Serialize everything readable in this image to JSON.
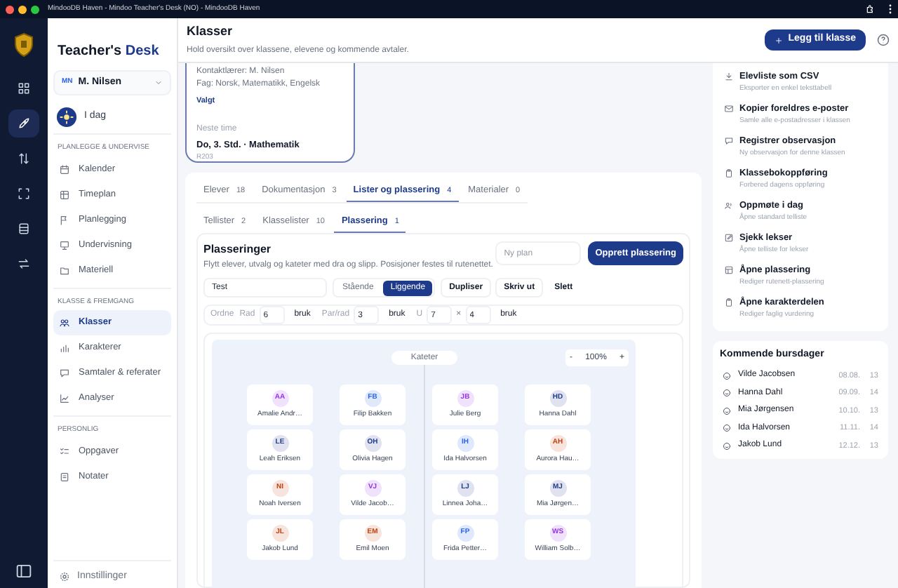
{
  "window": {
    "title": "MindooDB Haven - Mindoo Teacher's Desk (NO) - MindooDB Haven"
  },
  "rail": [
    {
      "selected": false
    },
    {
      "selected": true
    },
    {
      "selected": false
    },
    {
      "selected": false
    },
    {
      "selected": false
    },
    {
      "selected": false
    }
  ],
  "sidebar": {
    "brand_prefix": "Teacher's",
    "brand_accent": "Desk",
    "user": {
      "initials": "MN",
      "name": "M. Nilsen"
    },
    "today": "I dag",
    "sections": [
      {
        "title": "PLANLEGGE & UNDERVISE",
        "items": [
          {
            "label": "Kalender",
            "selected": false
          },
          {
            "label": "Timeplan",
            "selected": false
          },
          {
            "label": "Planlegging",
            "selected": false
          },
          {
            "label": "Undervisning",
            "selected": false
          },
          {
            "label": "Materiell",
            "selected": false
          }
        ]
      },
      {
        "title": "KLASSE & FREMGANG",
        "items": [
          {
            "label": "Klasser",
            "selected": true
          },
          {
            "label": "Karakterer",
            "selected": false
          },
          {
            "label": "Samtaler & referater",
            "selected": false
          },
          {
            "label": "Analyser",
            "selected": false
          }
        ]
      },
      {
        "title": "PERSONLIG",
        "items": [
          {
            "label": "Oppgaver",
            "selected": false
          },
          {
            "label": "Notater",
            "selected": false
          }
        ]
      }
    ],
    "settings": "Innstillinger"
  },
  "header": {
    "title": "Klasser",
    "subtitle": "Hold oversikt over klassene, elevene og kommende avtaler.",
    "add_button": "Legg til klasse"
  },
  "class_card": {
    "lines": [
      "Kontaktlærer: M. Nilsen",
      "Fag: Norsk, Matematikk, Engelsk"
    ],
    "status": "Valgt",
    "next_label": "Neste time",
    "next_lesson": "Do, 3. Std. · Mathematik",
    "room": "R203"
  },
  "tabs": [
    {
      "label": "Elever",
      "count": "18",
      "selected": false
    },
    {
      "label": "Dokumentasjon",
      "count": "3",
      "selected": false
    },
    {
      "label": "Lister og plassering",
      "count": "4",
      "selected": true
    },
    {
      "label": "Materialer",
      "count": "0",
      "selected": false
    }
  ],
  "subtabs": [
    {
      "label": "Tellister",
      "count": "2",
      "selected": false
    },
    {
      "label": "Klasselister",
      "count": "10",
      "selected": false
    },
    {
      "label": "Plassering",
      "count": "1",
      "selected": true
    }
  ],
  "seating": {
    "title": "Plasseringer",
    "description": "Flytt elever, utvalg og kateter med dra og slipp. Posisjoner festes til rutenettet.",
    "new_plan_placeholder": "Ny plan",
    "create_button": "Opprett plassering",
    "plan_name": "Test",
    "orientation": [
      {
        "label": "Stående",
        "selected": false
      },
      {
        "label": "Liggende",
        "selected": true
      }
    ],
    "actions": [
      "Dupliser",
      "Skriv ut",
      "Slett"
    ],
    "arrange": {
      "label": "Ordne",
      "groups": [
        {
          "label": "Rad",
          "values": [
            "6"
          ],
          "apply": "bruk"
        },
        {
          "label": "Par/rad",
          "values": [
            "3"
          ],
          "apply": "bruk"
        },
        {
          "label": "U",
          "values": [
            "7",
            "4"
          ],
          "separator": "×",
          "apply": "bruk"
        }
      ]
    }
  },
  "canvas": {
    "desk_label": "Kateter",
    "zoom_out": "-",
    "zoom": "100%",
    "zoom_in": "+",
    "students": [
      {
        "initials": "AA",
        "name": "Amalie Andr…",
        "color": "#9333ea"
      },
      {
        "initials": "FB",
        "name": "Filip Bakken",
        "color": "#2563eb"
      },
      {
        "initials": "JB",
        "name": "Julie Berg",
        "color": "#9333ea"
      },
      {
        "initials": "HD",
        "name": "Hanna Dahl",
        "color": "#1e3a8a"
      },
      {
        "initials": "LE",
        "name": "Leah Eriksen",
        "color": "#1e3a8a"
      },
      {
        "initials": "OH",
        "name": "Olivia Hagen",
        "color": "#1e3a8a"
      },
      {
        "initials": "IH",
        "name": "Ida Halvorsen",
        "color": "#2563eb"
      },
      {
        "initials": "AH",
        "name": "Aurora Hau…",
        "color": "#c2410c"
      },
      {
        "initials": "NI",
        "name": "Noah Iversen",
        "color": "#c2410c"
      },
      {
        "initials": "VJ",
        "name": "Vilde Jacob…",
        "color": "#9333ea"
      },
      {
        "initials": "LJ",
        "name": "Linnea Joha…",
        "color": "#1e3a8a"
      },
      {
        "initials": "MJ",
        "name": "Mia Jørgen…",
        "color": "#1e3a8a"
      },
      {
        "initials": "JL",
        "name": "Jakob Lund",
        "color": "#c2410c"
      },
      {
        "initials": "EM",
        "name": "Emil Moen",
        "color": "#c2410c"
      },
      {
        "initials": "FP",
        "name": "Frida Petter…",
        "color": "#2563eb"
      },
      {
        "initials": "WS",
        "name": "William Solb…",
        "color": "#9333ea"
      }
    ]
  },
  "actions": [
    {
      "title": "Elevliste som CSV",
      "subtitle": "Eksporter en enkel teksttabell"
    },
    {
      "title": "Kopier foreldres e-poster",
      "subtitle": "Samle alle e-postadresser i klassen"
    },
    {
      "title": "Registrer observasjon",
      "subtitle": "Ny observasjon for denne klassen"
    },
    {
      "title": "Klassebokoppføring",
      "subtitle": "Forbered dagens oppføring"
    },
    {
      "title": "Oppmøte i dag",
      "subtitle": "Åpne standard telliste"
    },
    {
      "title": "Sjekk lekser",
      "subtitle": "Åpne telliste for lekser"
    },
    {
      "title": "Åpne plassering",
      "subtitle": "Rediger rutenett-plassering"
    },
    {
      "title": "Åpne karakterdelen",
      "subtitle": "Rediger faglig vurdering"
    }
  ],
  "birthdays": {
    "title": "Kommende bursdager",
    "items": [
      {
        "name": "Vilde Jacobsen",
        "date": "08.08.",
        "age": "13"
      },
      {
        "name": "Hanna Dahl",
        "date": "09.09.",
        "age": "14"
      },
      {
        "name": "Mia Jørgensen",
        "date": "10.10.",
        "age": "13"
      },
      {
        "name": "Ida Halvorsen",
        "date": "11.11.",
        "age": "14"
      },
      {
        "name": "Jakob Lund",
        "date": "12.12.",
        "age": "13"
      }
    ]
  }
}
